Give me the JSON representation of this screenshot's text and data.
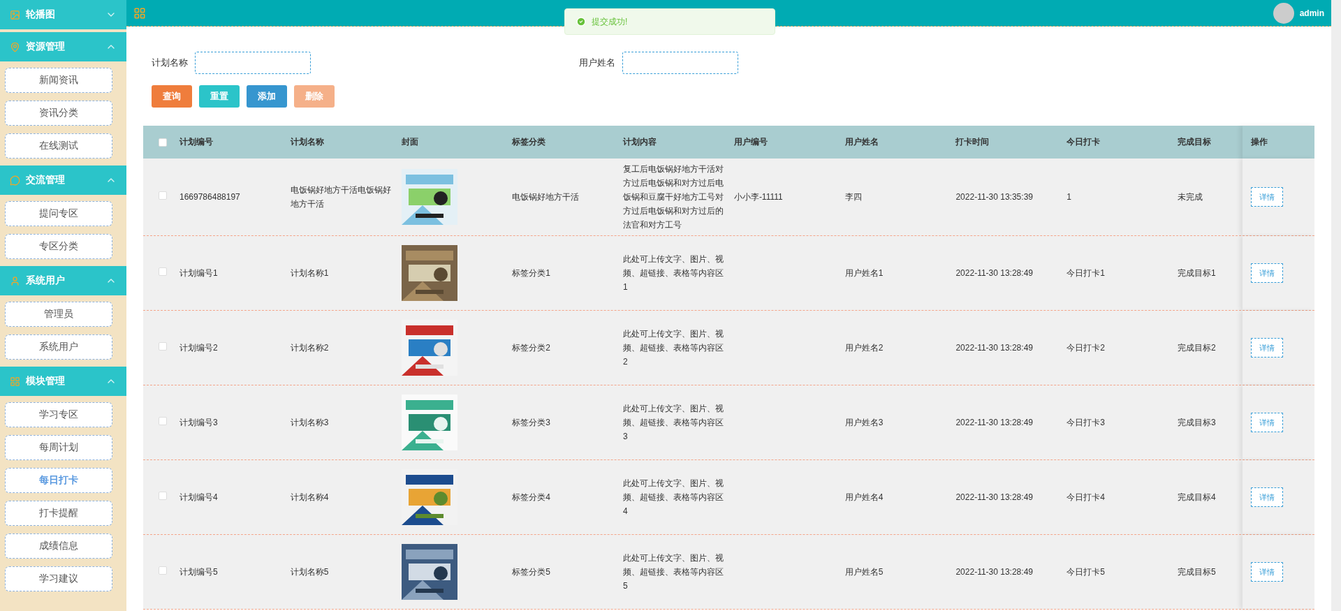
{
  "header": {
    "user": "admin"
  },
  "toast": {
    "message": "提交成功!"
  },
  "sidebar": {
    "groups": [
      {
        "title": "轮播图",
        "expanded": false
      },
      {
        "title": "资源管理",
        "expanded": true,
        "items": [
          {
            "label": "新闻资讯",
            "selected": false
          },
          {
            "label": "资讯分类",
            "selected": false
          },
          {
            "label": "在线测试",
            "selected": false
          }
        ]
      },
      {
        "title": "交流管理",
        "expanded": true,
        "items": [
          {
            "label": "提问专区",
            "selected": false
          },
          {
            "label": "专区分类",
            "selected": false
          }
        ]
      },
      {
        "title": "系统用户",
        "expanded": true,
        "items": [
          {
            "label": "管理员",
            "selected": false
          },
          {
            "label": "系统用户",
            "selected": false
          }
        ]
      },
      {
        "title": "模块管理",
        "expanded": true,
        "items": [
          {
            "label": "学习专区",
            "selected": false
          },
          {
            "label": "每周计划",
            "selected": false
          },
          {
            "label": "每日打卡",
            "selected": true
          },
          {
            "label": "打卡提醒",
            "selected": false
          },
          {
            "label": "成绩信息",
            "selected": false
          },
          {
            "label": "学习建议",
            "selected": false
          }
        ]
      }
    ]
  },
  "search": {
    "fields": [
      {
        "label": "计划名称"
      },
      {
        "label": "用户姓名"
      }
    ],
    "buttons": [
      {
        "label": "查询",
        "kind": "query",
        "disabled": false
      },
      {
        "label": "重置",
        "kind": "reset",
        "disabled": false
      },
      {
        "label": "添加",
        "kind": "add",
        "disabled": false
      },
      {
        "label": "删除",
        "kind": "delete",
        "disabled": true
      }
    ]
  },
  "table": {
    "select_all": {
      "checked": false
    },
    "columns": [
      "计划编号",
      "计划名称",
      "封面",
      "标签分类",
      "计划内容",
      "用户编号",
      "用户姓名",
      "打卡时间",
      "今日打卡",
      "完成目标",
      "操作"
    ],
    "rows": [
      {
        "checked": false,
        "cells": [
          "1669786488197",
          "电饭锅好地方干活电饭锅好地方干活",
          "",
          "电饭锅好地方干活",
          "复工后电饭锅好地方干活对方过后电饭锅和对方过后电饭锅和豆腐干好地方工号对方过后电饭锅和对方过后的法官和对方工号",
          "小小李-11111",
          "李四",
          "2022-11-30 13:35:39",
          "1",
          "未完成"
        ],
        "action": "详情"
      },
      {
        "checked": false,
        "cells": [
          "计划编号1",
          "计划名称1",
          "",
          "标签分类1",
          "此处可上传文字、图片、视频、超链接、表格等内容区1",
          "",
          "用户姓名1",
          "2022-11-30 13:28:49",
          "今日打卡1",
          "完成目标1"
        ],
        "action": "详情"
      },
      {
        "checked": false,
        "cells": [
          "计划编号2",
          "计划名称2",
          "",
          "标签分类2",
          "此处可上传文字、图片、视频、超链接、表格等内容区2",
          "",
          "用户姓名2",
          "2022-11-30 13:28:49",
          "今日打卡2",
          "完成目标2"
        ],
        "action": "详情"
      },
      {
        "checked": false,
        "cells": [
          "计划编号3",
          "计划名称3",
          "",
          "标签分类3",
          "此处可上传文字、图片、视频、超链接、表格等内容区3",
          "",
          "用户姓名3",
          "2022-11-30 13:28:49",
          "今日打卡3",
          "完成目标3"
        ],
        "action": "详情"
      },
      {
        "checked": false,
        "cells": [
          "计划编号4",
          "计划名称4",
          "",
          "标签分类4",
          "此处可上传文字、图片、视频、超链接、表格等内容区4",
          "",
          "用户姓名4",
          "2022-11-30 13:28:49",
          "今日打卡4",
          "完成目标4"
        ],
        "action": "详情"
      },
      {
        "checked": false,
        "cells": [
          "计划编号5",
          "计划名称5",
          "",
          "标签分类5",
          "此处可上传文字、图片、视频、超链接、表格等内容区5",
          "",
          "用户姓名5",
          "2022-11-30 13:28:49",
          "今日打卡5",
          "完成目标5"
        ],
        "action": "详情"
      }
    ]
  }
}
